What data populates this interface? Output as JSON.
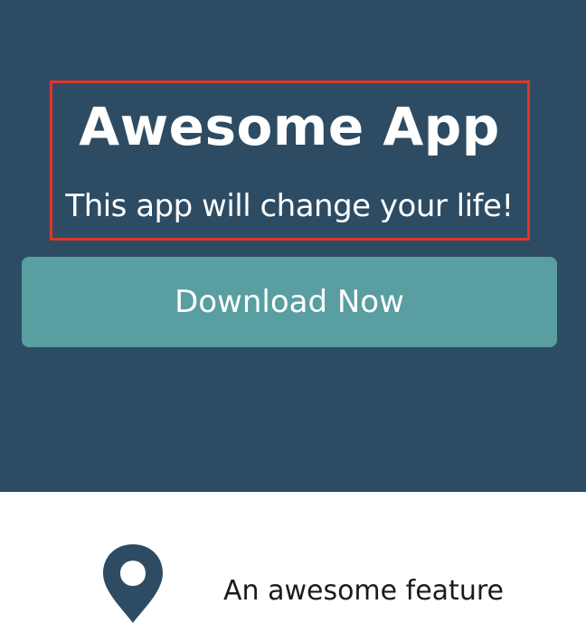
{
  "hero": {
    "title": "Awesome App",
    "tagline": "This app will change your life!",
    "download_label": "Download Now"
  },
  "features": {
    "items": [
      {
        "icon": "map-pin-icon",
        "label": "An awesome feature"
      }
    ]
  },
  "colors": {
    "hero_background": "#2d4c63",
    "button": "#599ea1",
    "highlight_border": "#e0342b"
  }
}
